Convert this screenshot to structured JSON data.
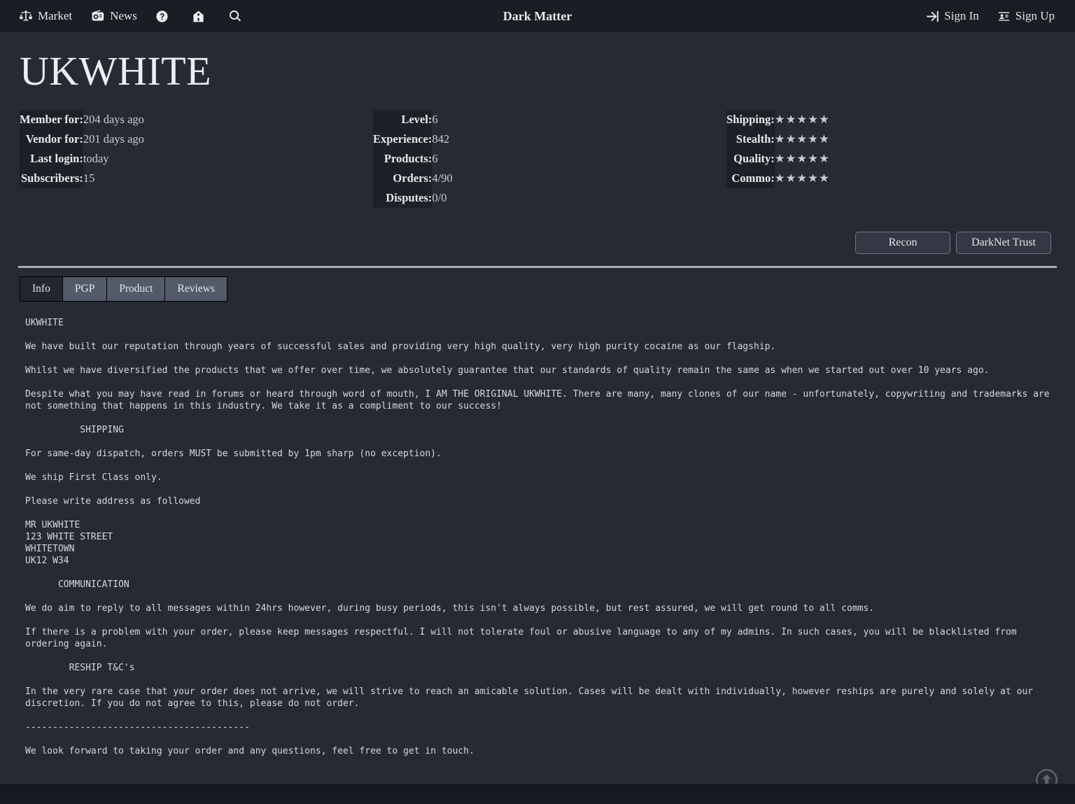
{
  "navbar": {
    "brand": "Dark Matter",
    "left_items": [
      {
        "label": "Market",
        "icon": "scales-icon"
      },
      {
        "label": "News",
        "icon": "radio-icon"
      },
      {
        "label": "",
        "icon": "question-circle-icon"
      },
      {
        "label": "",
        "icon": "home-icon"
      },
      {
        "label": "",
        "icon": "search-icon"
      }
    ],
    "right_items": [
      {
        "label": "Sign In",
        "icon": "sign-in-icon"
      },
      {
        "label": "Sign Up",
        "icon": "id-card-icon"
      }
    ]
  },
  "vendor": {
    "name": "UKWHITE"
  },
  "stats": {
    "left": [
      {
        "label": "Member for:",
        "value": "204 days ago"
      },
      {
        "label": "Vendor for:",
        "value": "201 days ago"
      },
      {
        "label": "Last login:",
        "value": "today"
      },
      {
        "label": "Subscribers:",
        "value": "15"
      }
    ],
    "middle": [
      {
        "label": "Level:",
        "value": "6"
      },
      {
        "label": "Experience:",
        "value": "842"
      },
      {
        "label": "Products:",
        "value": "6"
      },
      {
        "label": "Orders:",
        "value": "4/90"
      },
      {
        "label": "Disputes:",
        "value": "0/0"
      }
    ],
    "right": [
      {
        "label": "Shipping:",
        "value": "★★★★★",
        "rating": 5
      },
      {
        "label": "Stealth:",
        "value": "★★★★★",
        "rating": 5
      },
      {
        "label": "Quality:",
        "value": "★★★★★",
        "rating": 5
      },
      {
        "label": "Commo:",
        "value": "★★★★★",
        "rating": 5
      }
    ]
  },
  "actions": {
    "recon": "Recon",
    "darknet_trust": "DarkNet Trust"
  },
  "tabs": [
    {
      "label": "Info",
      "active": true
    },
    {
      "label": "PGP",
      "active": false
    },
    {
      "label": "Product",
      "active": false
    },
    {
      "label": "Reviews",
      "active": false
    }
  ],
  "info": {
    "text": "UKWHITE\n\nWe have built our reputation through years of successful sales and providing very high quality, very high purity cocaine as our flagship.\n\nWhilst we have diversified the products that we offer over time, we absolutely guarantee that our standards of quality remain the same as when we started out over 10 years ago.\n\nDespite what you may have read in forums or heard through word of mouth, I AM THE ORIGINAL UKWHITE. There are many, many clones of our name - unfortunately, copywriting and trademarks are not something that happens in this industry. We take it as a compliment to our success!\n\n          SHIPPING\n\nFor same-day dispatch, orders MUST be submitted by 1pm sharp (no exception).\n\nWe ship First Class only.\n\nPlease write address as followed\n\nMR UKWHITE\n123 WHITE STREET\nWHITETOWN\nUK12 W34\n\n      COMMUNICATION\n\nWe do aim to reply to all messages within 24hrs however, during busy periods, this isn't always possible, but rest assured, we will get round to all comms.\n\nIf there is a problem with your order, please keep messages respectful. I will not tolerate foul or abusive language to any of my admins. In such cases, you will be blacklisted from ordering again.\n\n        RESHIP T&C's\n\nIn the very rare case that your order does not arrive, we will strive to reach an amicable solution. Cases will be dealt with individually, however reships are purely and solely at our discretion. If you do not agree to this, please do not order.\n\n-----------------------------------------\n\nWe look forward to taking your order and any questions, feel free to get in touch."
  },
  "colors": {
    "page_bg": "#252a33",
    "navbar_bg": "#1a1d23",
    "label_bg": "#1d2026",
    "footer_bg": "#16191f",
    "tab_inactive": "#535a68",
    "tab_active": "#22262e",
    "text": "#d7d9de"
  }
}
